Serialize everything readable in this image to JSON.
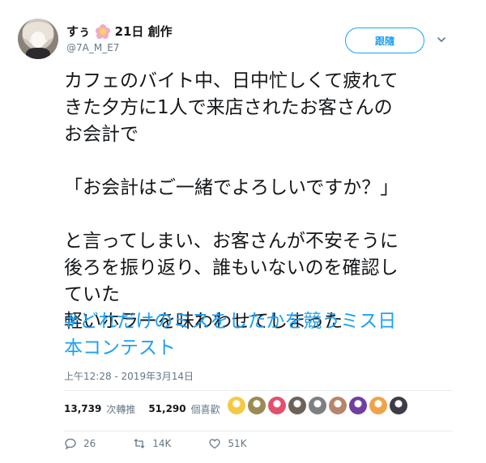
{
  "author": {
    "name": "すぅ",
    "name_suffix": "21日 創作",
    "handle": "@7A_M_E7"
  },
  "follow_label": "跟隨",
  "tweet": {
    "text": "カフェのバイト中、日中忙しくて疲れて\nきた夕方に1人で来店されたお客さんの\nお会計で\n\n「お会計はご一緒でよろしいですか？」\n\nと言ってしまい、お客さんが不安そうに\n後ろを振り返り、誰もいないのを確認し\nていた\n軽いホラーを味わわせてしまった",
    "hashtag": "#どれだけのミスをしたかを競うミス日\n本コンテスト",
    "timestamp": "上午12:28 - 2019年3月14日"
  },
  "stats": {
    "retweets": "13,739",
    "retweets_label": "次轉推",
    "likes": "51,290",
    "likes_label": "個喜歡"
  },
  "liker_avatars": [
    {
      "icon": "emoji-face-avatar",
      "color": "#f6c945"
    },
    {
      "icon": "plant-avatar",
      "color": "#9a8a54"
    },
    {
      "icon": "lips-avatar",
      "color": "#e2506e"
    },
    {
      "icon": "mask-avatar",
      "color": "#6c6257"
    },
    {
      "icon": "bird-avatar",
      "color": "#7d7f83"
    },
    {
      "icon": "brown-hair-avatar",
      "color": "#b8846a"
    },
    {
      "icon": "purple-avatar",
      "color": "#6e3fa0"
    },
    {
      "icon": "orange-hair-avatar",
      "color": "#f0a24a"
    },
    {
      "icon": "dark-character-avatar",
      "color": "#3c3c4a"
    }
  ],
  "actions": {
    "replies": "26",
    "retweets": "14K",
    "likes": "51K"
  },
  "colors": {
    "accent": "#1da1f2",
    "secondary_text": "#657786",
    "divider": "#e6ecf0"
  }
}
